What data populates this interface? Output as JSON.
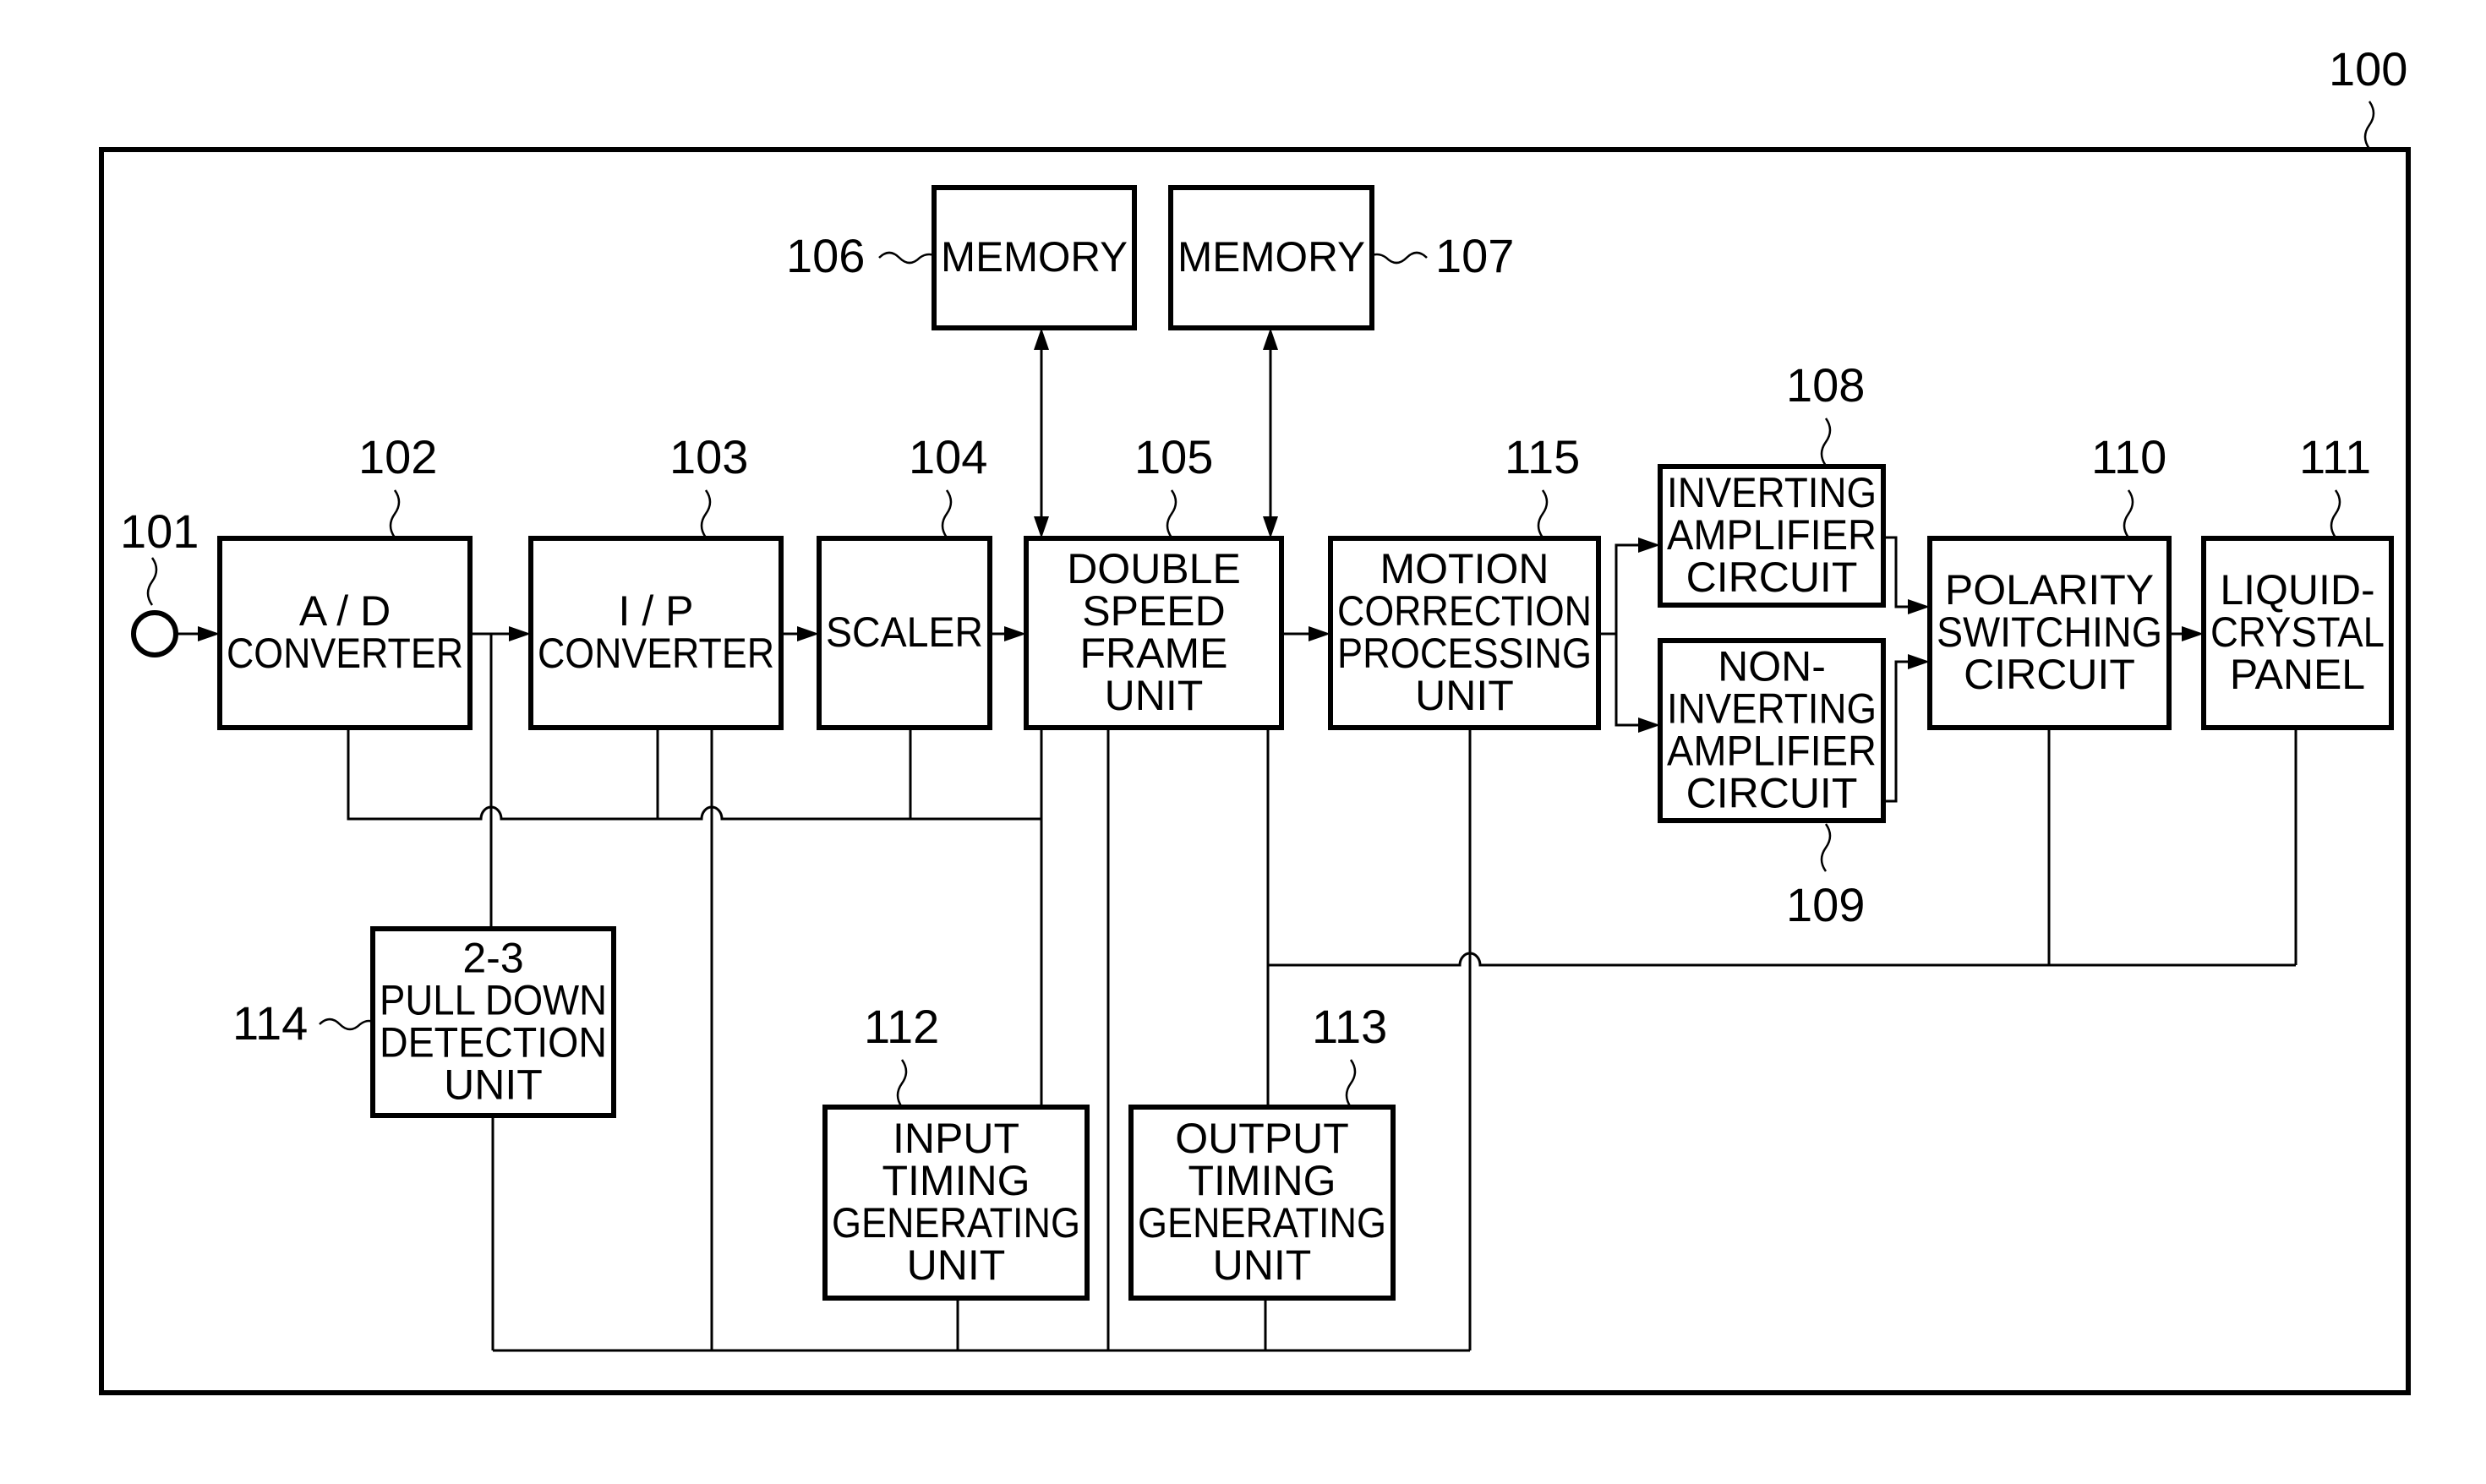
{
  "figure": {
    "system_ref": "100",
    "input_terminal": {
      "ref": "101"
    },
    "blocks": {
      "ad": {
        "ref": "102",
        "lines": [
          "A / D",
          "CONVERTER"
        ]
      },
      "ip": {
        "ref": "103",
        "lines": [
          "I / P",
          "CONVERTER"
        ]
      },
      "scaler": {
        "ref": "104",
        "lines": [
          "SCALER"
        ]
      },
      "double": {
        "ref": "105",
        "lines": [
          "DOUBLE",
          "SPEED",
          "FRAME",
          "UNIT"
        ]
      },
      "mem1": {
        "ref": "106",
        "lines": [
          "MEMORY"
        ]
      },
      "mem2": {
        "ref": "107",
        "lines": [
          "MEMORY"
        ]
      },
      "inv": {
        "ref": "108",
        "lines": [
          "INVERTING",
          "AMPLIFIER",
          "CIRCUIT"
        ]
      },
      "noninv": {
        "ref": "109",
        "lines": [
          "NON-",
          "INVERTING",
          "AMPLIFIER",
          "CIRCUIT"
        ]
      },
      "polarity": {
        "ref": "110",
        "lines": [
          "POLARITY",
          "SWITCHING",
          "CIRCUIT"
        ]
      },
      "lcd": {
        "ref": "111",
        "lines": [
          "LIQUID-",
          "CRYSTAL",
          "PANEL"
        ]
      },
      "intiming": {
        "ref": "112",
        "lines": [
          "INPUT",
          "TIMING",
          "GENERATING",
          "UNIT"
        ]
      },
      "outtiming": {
        "ref": "113",
        "lines": [
          "OUTPUT",
          "TIMING",
          "GENERATING",
          "UNIT"
        ]
      },
      "pulldown": {
        "ref": "114",
        "lines": [
          "2-3",
          "PULL DOWN",
          "DETECTION",
          "UNIT"
        ]
      },
      "motion": {
        "ref": "115",
        "lines": [
          "MOTION",
          "CORRECTION",
          "PROCESSING",
          "UNIT"
        ]
      }
    }
  }
}
